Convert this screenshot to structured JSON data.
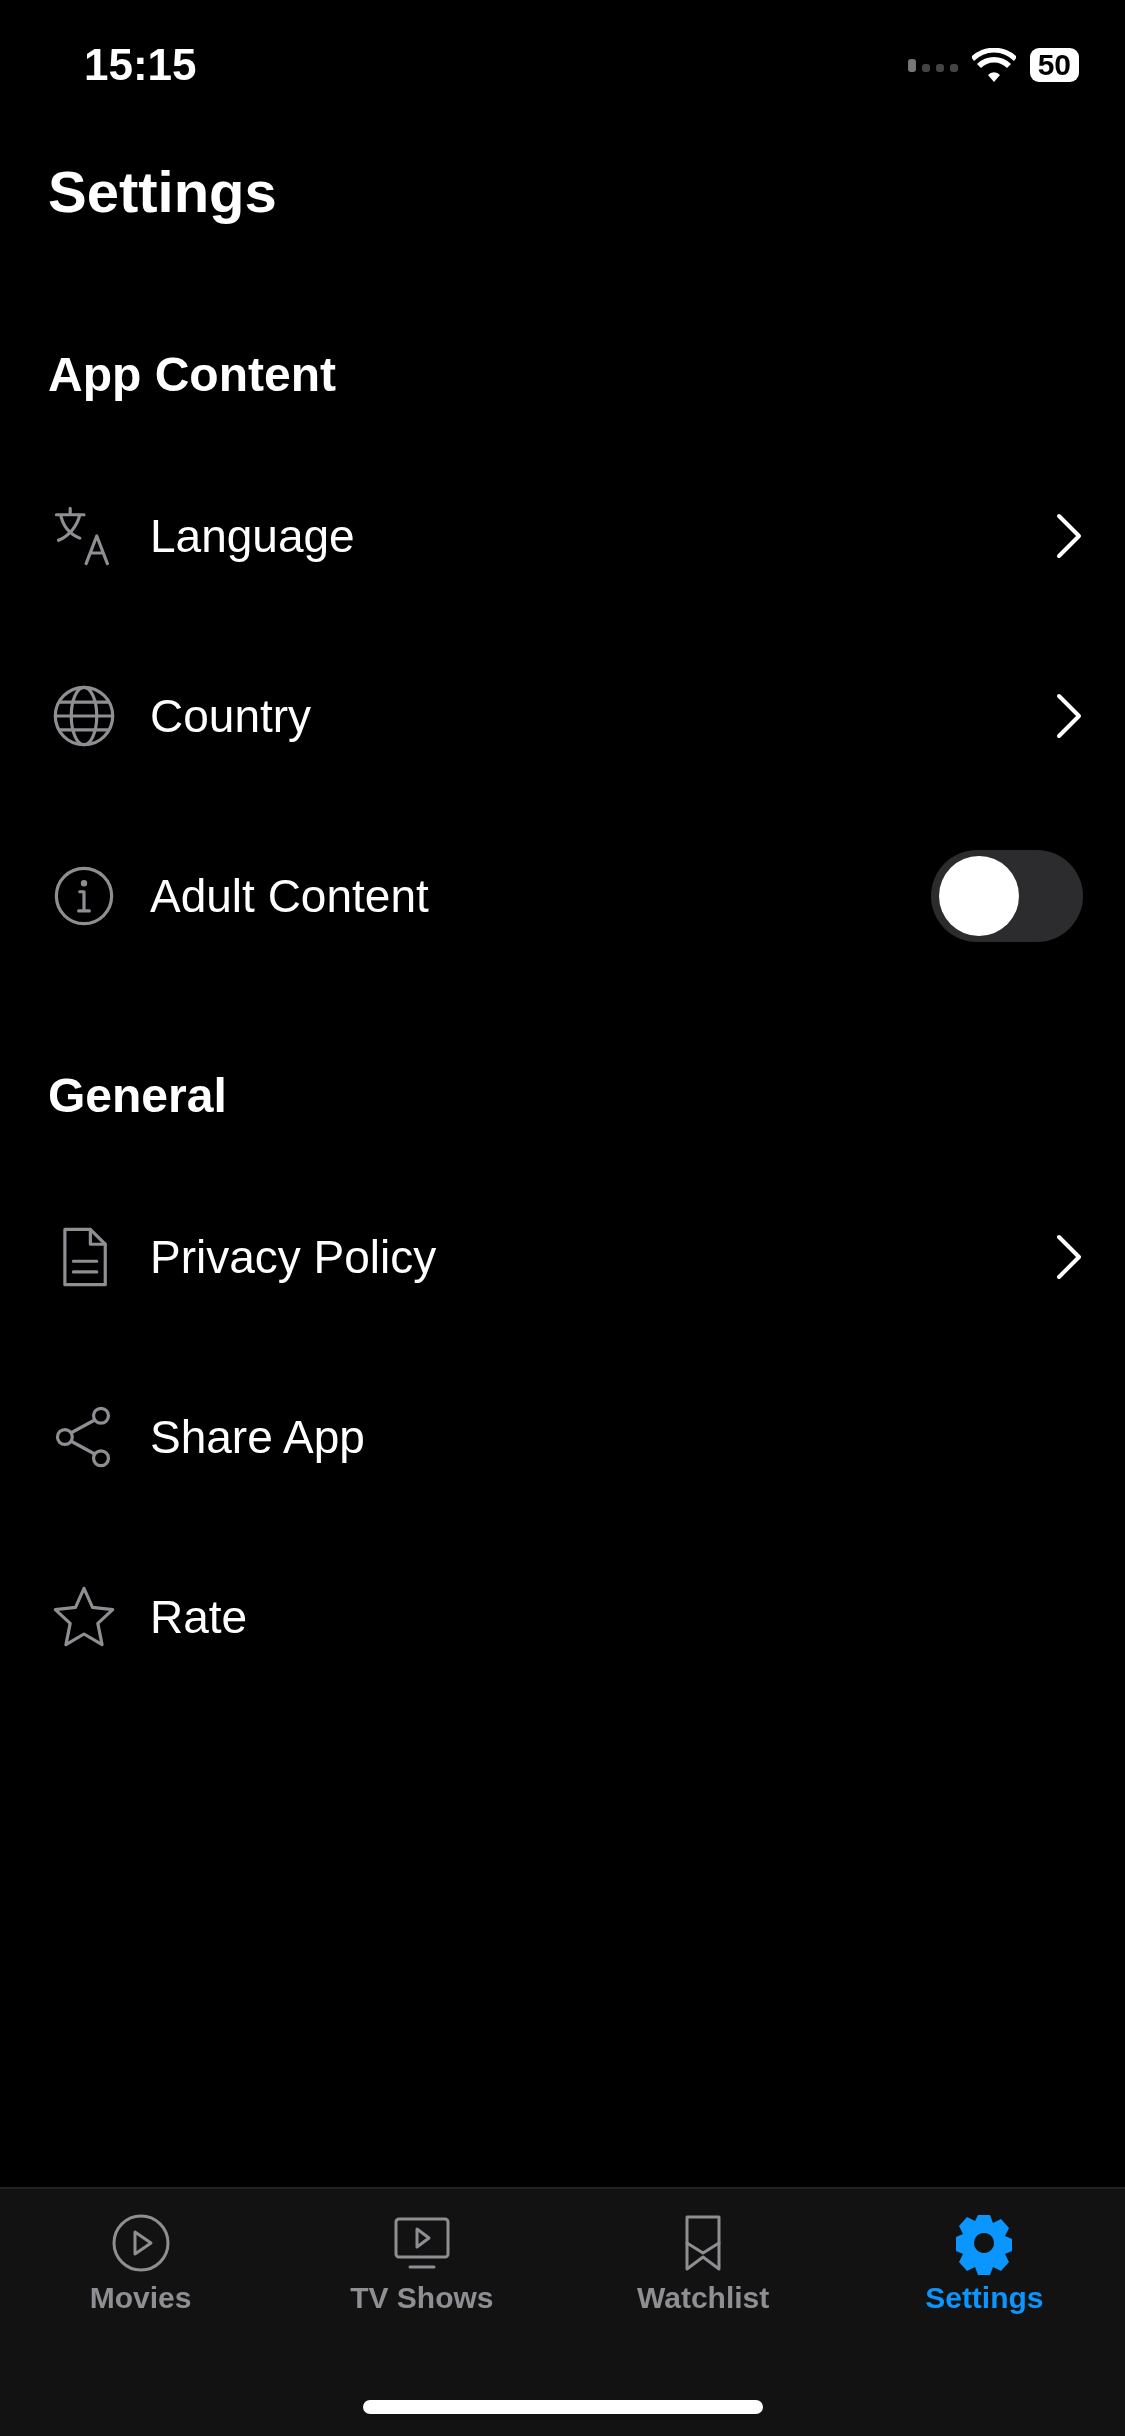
{
  "status_bar": {
    "time": "15:15",
    "battery": "50"
  },
  "title": "Settings",
  "sections": [
    {
      "heading": "App Content",
      "rows": [
        {
          "label": "Language",
          "kind": "link"
        },
        {
          "label": "Country",
          "kind": "link"
        },
        {
          "label": "Adult Content",
          "kind": "toggle",
          "on": false
        }
      ]
    },
    {
      "heading": "General",
      "rows": [
        {
          "label": "Privacy Policy",
          "kind": "link"
        },
        {
          "label": "Share App",
          "kind": "plain"
        },
        {
          "label": "Rate",
          "kind": "plain"
        }
      ]
    }
  ],
  "tabs": [
    {
      "label": "Movies",
      "selected": false
    },
    {
      "label": "TV Shows",
      "selected": false
    },
    {
      "label": "Watchlist",
      "selected": false
    },
    {
      "label": "Settings",
      "selected": true
    }
  ]
}
